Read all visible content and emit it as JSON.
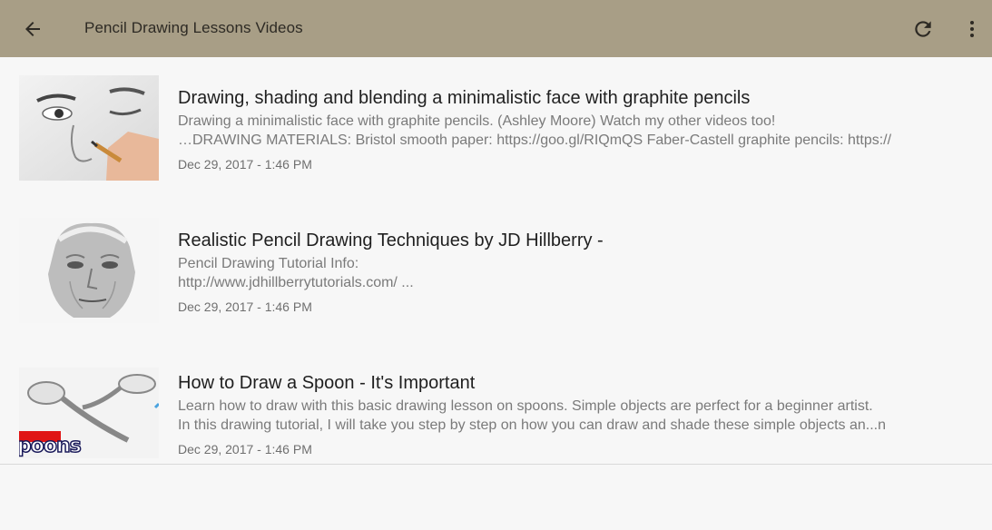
{
  "appbar": {
    "title": "Pencil Drawing Lessons Videos",
    "back_icon": "arrow-back-icon",
    "refresh_icon": "refresh-icon",
    "more_icon": "more-vert-icon",
    "background": "#a89e86"
  },
  "videos": [
    {
      "title": "Drawing, shading and blending a minimalistic face with graphite pencils",
      "description": "Drawing a minimalistic face with graphite pencils. (Ashley Moore) Watch my other videos too!\n…DRAWING MATERIALS: Bristol smooth paper: https://goo.gl/RIQmQS Faber-Castell graphite pencils: https://",
      "date": "Dec 29, 2017 - 1:46 PM"
    },
    {
      "title": "Realistic Pencil Drawing Techniques by JD Hillberry -",
      "description": "Pencil Drawing Tutorial Info:\nhttp://www.jdhillberrytutorials.com/ ...",
      "date": "Dec 29, 2017 - 1:46 PM"
    },
    {
      "title": "How to Draw a Spoon - It's Important",
      "description": "Learn how to draw with this basic drawing lesson on spoons. Simple objects are perfect for a beginner artist.\nIn this drawing tutorial, I will take you step by step on how you can draw and shade these simple objects an...n",
      "date": "Dec 29, 2017 - 1:46 PM",
      "thumb_text": "poons"
    }
  ]
}
